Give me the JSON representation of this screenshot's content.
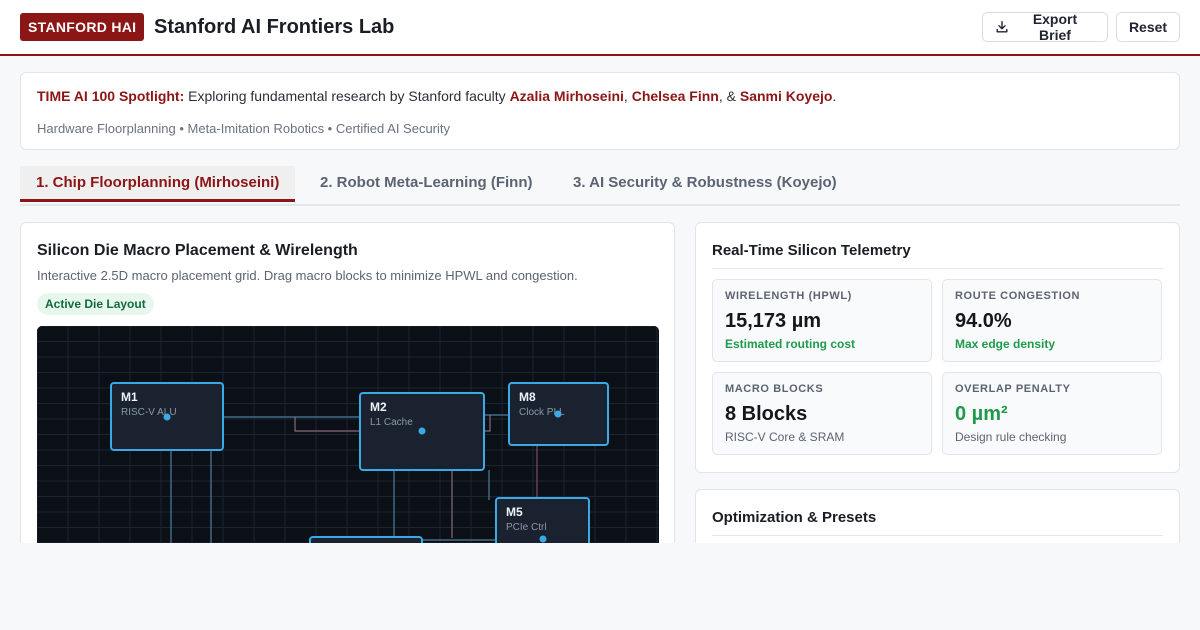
{
  "header": {
    "brand": "STANFORD HAI",
    "title": "Stanford AI Frontiers Lab",
    "export_label": "Export Brief",
    "reset_label": "Reset"
  },
  "spotlight": {
    "lead": "TIME AI 100 Spotlight:",
    "text": " Exploring fundamental research by Stanford faculty ",
    "faculty": [
      "Azalia Mirhoseini",
      "Chelsea Finn",
      "Sanmi Koyejo"
    ],
    "sep1": ", ",
    "sep2": ", & ",
    "end": ".",
    "topics": "Hardware Floorplanning • Meta-Imitation Robotics • Certified AI Security"
  },
  "tabs": [
    {
      "label": "1. Chip Floorplanning (Mirhoseini)",
      "active": true
    },
    {
      "label": "2. Robot Meta-Learning (Finn)",
      "active": false
    },
    {
      "label": "3. AI Security & Robustness (Koyejo)",
      "active": false
    }
  ],
  "die_panel": {
    "title": "Silicon Die Macro Placement & Wirelength",
    "subtitle": "Interactive 2.5D macro placement grid. Drag macro blocks to minimize HPWL and congestion.",
    "badge": "Active Die Layout",
    "macros": [
      {
        "id": "M1",
        "label": "RISC-V ALU"
      },
      {
        "id": "M2",
        "label": "L1 Cache"
      },
      {
        "id": "M8",
        "label": "Clock PLL"
      },
      {
        "id": "M5",
        "label": "PCIe Ctrl"
      }
    ]
  },
  "telemetry": {
    "title": "Real-Time Silicon Telemetry",
    "cards": [
      {
        "label": "WIRELENGTH (HPWL)",
        "value": "15,173 µm",
        "note": "Estimated routing cost"
      },
      {
        "label": "ROUTE CONGESTION",
        "value": "94.0%",
        "note": "Max edge density"
      },
      {
        "label": "MACRO BLOCKS",
        "value": "8 Blocks",
        "note": "RISC-V Core & SRAM"
      },
      {
        "label": "OVERLAP PENALTY",
        "value": "0 µm²",
        "note": "Design rule checking"
      }
    ]
  },
  "optimization": {
    "title": "Optimization & Presets"
  },
  "colors": {
    "brand": "#8c1515",
    "success": "#1f9a4a",
    "macro_border": "#3aa9e6",
    "die_background": "#0b0f16"
  }
}
